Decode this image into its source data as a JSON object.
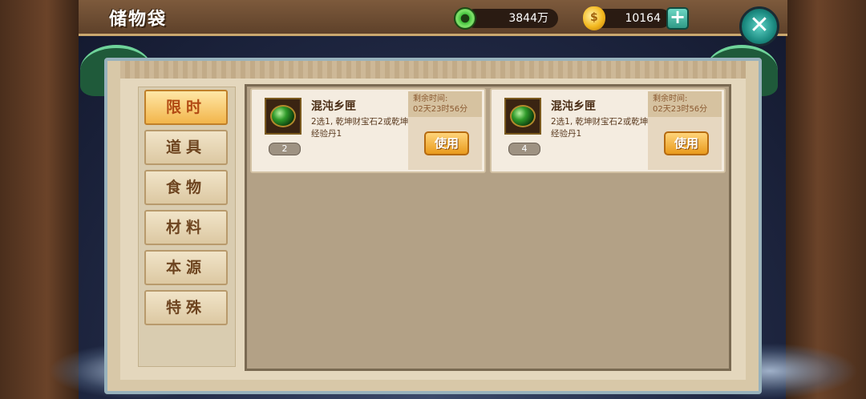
{
  "header": {
    "title": "储物袋",
    "jade_amount": "3844万",
    "gold_amount": "10164",
    "plus_label": "+",
    "close_label": "✕"
  },
  "sidebar": {
    "tabs": [
      {
        "label": "限时",
        "active": true
      },
      {
        "label": "道具",
        "active": false
      },
      {
        "label": "食物",
        "active": false
      },
      {
        "label": "材料",
        "active": false
      },
      {
        "label": "本源",
        "active": false
      },
      {
        "label": "特殊",
        "active": false
      }
    ]
  },
  "items": [
    {
      "name": "混沌乡匣",
      "description": "2选1, 乾坤财宝石2或乾坤经验丹1",
      "count": "2",
      "timer_label": "剩余时间:",
      "timer_value": "02天23时56分",
      "use_label": "使用",
      "icon": "green-gem-icon"
    },
    {
      "name": "混沌乡匣",
      "description": "2选1, 乾坤财宝石2或乾坤经验丹1",
      "count": "4",
      "timer_label": "剩余时间:",
      "timer_value": "02天23时56分",
      "use_label": "使用",
      "icon": "green-gem-icon"
    }
  ],
  "colors": {
    "active_tab": "#f2b54b",
    "use_button": "#e99a1c",
    "close_button": "#1b8a80"
  }
}
